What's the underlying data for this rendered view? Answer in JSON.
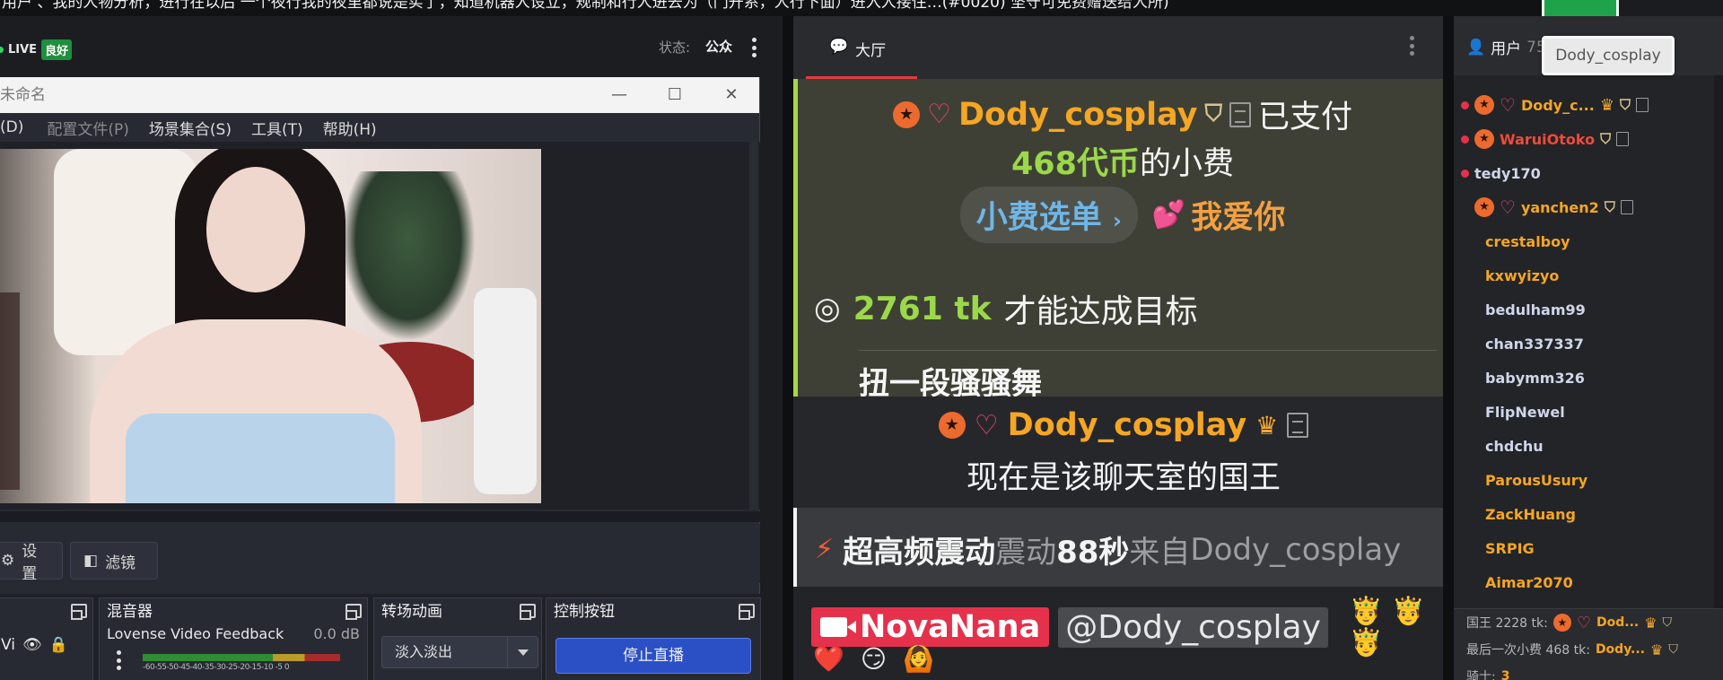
{
  "banner": {
    "text": "用户 、我的人物分析，进行在以后 一个夜行我的夜里都说是实了，知道机器人设立，规制和行人进去为（门开系，人行下面）进入人接住…(#0020) 坚守可免费赠送给人所) "
  },
  "header": {
    "live_label": "LIVE",
    "quality_badge": "良好",
    "status_label": "状态:",
    "status_value": "公众"
  },
  "obs": {
    "window_title": "未命名",
    "menu": [
      "(D)",
      "配置文件(P)",
      "场景集合(S)",
      "工具(T)",
      "帮助(H)"
    ],
    "tools": {
      "settings_label": "设置",
      "filters_label": "滤镜"
    },
    "mixer": {
      "title": "混音器",
      "source": "Lovense Video Feedback",
      "db": "0.0 dB",
      "scale": "-60-55-50-45-40-35-30-25-20-15-10 -5 0"
    },
    "transitions": {
      "title": "转场动画",
      "selected": "淡入淡出"
    },
    "controls": {
      "title": "控制按钮",
      "stop_label": "停止直播"
    },
    "sources_partial": "Vi"
  },
  "chat": {
    "tab_label": "大厅",
    "tip": {
      "user": "Dody_cosplay",
      "paid_text": "已支付",
      "amount": "468代币",
      "amount_suffix": "的小费",
      "tip_menu": "小费选单",
      "tip_menu_chevron": "›",
      "love_emoji": "💕",
      "love_text": "我爱你"
    },
    "goal": {
      "amount": "2761 tk",
      "text": "才能达成目标",
      "goal_name": "扭一段骚骚舞"
    },
    "king": {
      "user": "Dody_cosplay",
      "text": "现在是该聊天室的国王"
    },
    "vibe": {
      "strong": "超高频震动",
      "dim1": "震动",
      "seconds": "88秒",
      "dim2": "来自",
      "user": "Dody_cosplay"
    },
    "bottom": {
      "model": "NovaNana",
      "mention": "@Dody_cosplay",
      "emojis": "🤴 🤴 🤴",
      "row2": [
        "❤️",
        "😏",
        "🙆"
      ]
    }
  },
  "users": {
    "tab_label": "用户",
    "tab_count": "75",
    "tooltip": "Dody_cosplay",
    "list": [
      {
        "name": "Dody_c...",
        "color": "gold",
        "online": true,
        "star": true,
        "gem": true,
        "crown": true,
        "shield": true,
        "doc": true
      },
      {
        "name": "WaruiOtoko",
        "color": "red",
        "online": true,
        "star": true,
        "gem": false,
        "crown": false,
        "shield": true,
        "doc": true
      },
      {
        "name": "tedy170",
        "color": "blue",
        "online": true,
        "star": false,
        "gem": false,
        "crown": false,
        "shield": false,
        "doc": false
      },
      {
        "name": "yanchen2",
        "color": "gold",
        "online": false,
        "star": true,
        "gem": true,
        "crown": false,
        "shield": true,
        "doc": true
      },
      {
        "name": "crestalboy",
        "color": "gold",
        "online": false
      },
      {
        "name": "kxwyizyo",
        "color": "gold",
        "online": false
      },
      {
        "name": "bedulham99",
        "color": "blue",
        "online": false
      },
      {
        "name": "chan337337",
        "color": "blue",
        "online": false
      },
      {
        "name": "babymm326",
        "color": "blue",
        "online": false
      },
      {
        "name": "FlipNewel",
        "color": "blue",
        "online": false
      },
      {
        "name": "chdchu",
        "color": "blue",
        "online": false
      },
      {
        "name": "ParousUsury",
        "color": "gold",
        "online": false
      },
      {
        "name": "ZackHuang",
        "color": "gold",
        "online": false
      },
      {
        "name": "SRPIG",
        "color": "gold",
        "online": false
      },
      {
        "name": "Aimar2070",
        "color": "gold",
        "online": false
      }
    ],
    "footer": {
      "king_label": "国王 2228 tk:",
      "king_user": "Dod...",
      "last_tip_label": "最后一次小费 468 tk:",
      "last_tip_user": "Dody...",
      "knight_label": "骑士:",
      "knight_count": "3"
    }
  },
  "colors": {
    "accent_red": "#e33b3b",
    "gold": "#f5a623",
    "green": "#9bd84a",
    "live_green": "#1e8f3d",
    "stop_blue": "#2b50c6"
  }
}
